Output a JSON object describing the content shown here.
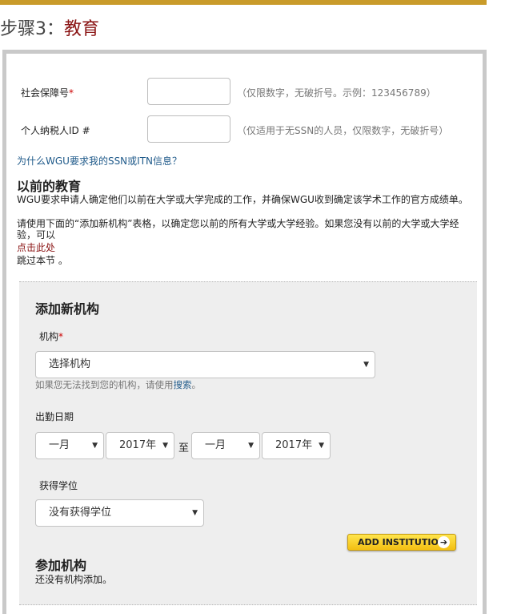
{
  "header": {
    "step_prefix": "步骤3：",
    "step_name": "教育"
  },
  "ssn": {
    "label": "社会保障号",
    "required_mark": "*",
    "value": "",
    "hint": "（仅限数字，无破折号。示例：123456789）"
  },
  "itin": {
    "label": "个人纳税人ID #",
    "value": "",
    "hint": "（仅适用于无SSN的人员，仅限数字，无破折号）"
  },
  "why_link": "为什么WGU要求我的SSN或ITN信息？",
  "previous_education": {
    "heading": "以前的教育",
    "intro": "WGU要求申请人确定他们以前在大学或大学完成的工作，并确保WGU收到确定该学术工作的官方成绩单。",
    "instruction": "请使用下面的“添加新机构”表格，以确定您以前的所有大学或大学经验。如果您没有以前的大学或大学经验，可以",
    "click_here": "点击此处",
    "skip_text": "跳过本节 。"
  },
  "add_institution": {
    "heading": "添加新机构",
    "institution_label": "机构",
    "required_mark": "*",
    "institution_selected": "选择机构",
    "cannot_find_text": "如果您无法找到您的机构，请使用",
    "search_link": "搜索",
    "cannot_find_suffix": "。",
    "attendance_label": "出勤日期",
    "from_month": "一月",
    "from_year": "2017年",
    "to_word": "至",
    "to_month": "一月",
    "to_year": "2017年",
    "degree_label": "获得学位",
    "degree_selected": "没有获得学位",
    "add_button": "ADD INSTITUTION"
  },
  "attended": {
    "heading": "参加机构",
    "empty_text": "还没有机构添加。"
  },
  "icons": {
    "select_arrow": "▼",
    "button_arrow": "➔"
  },
  "colors": {
    "accent_bar": "#c99b2a",
    "step_accent": "#8b1515",
    "link": "#1f5a8a",
    "button_yellow": "#f3bf12"
  }
}
